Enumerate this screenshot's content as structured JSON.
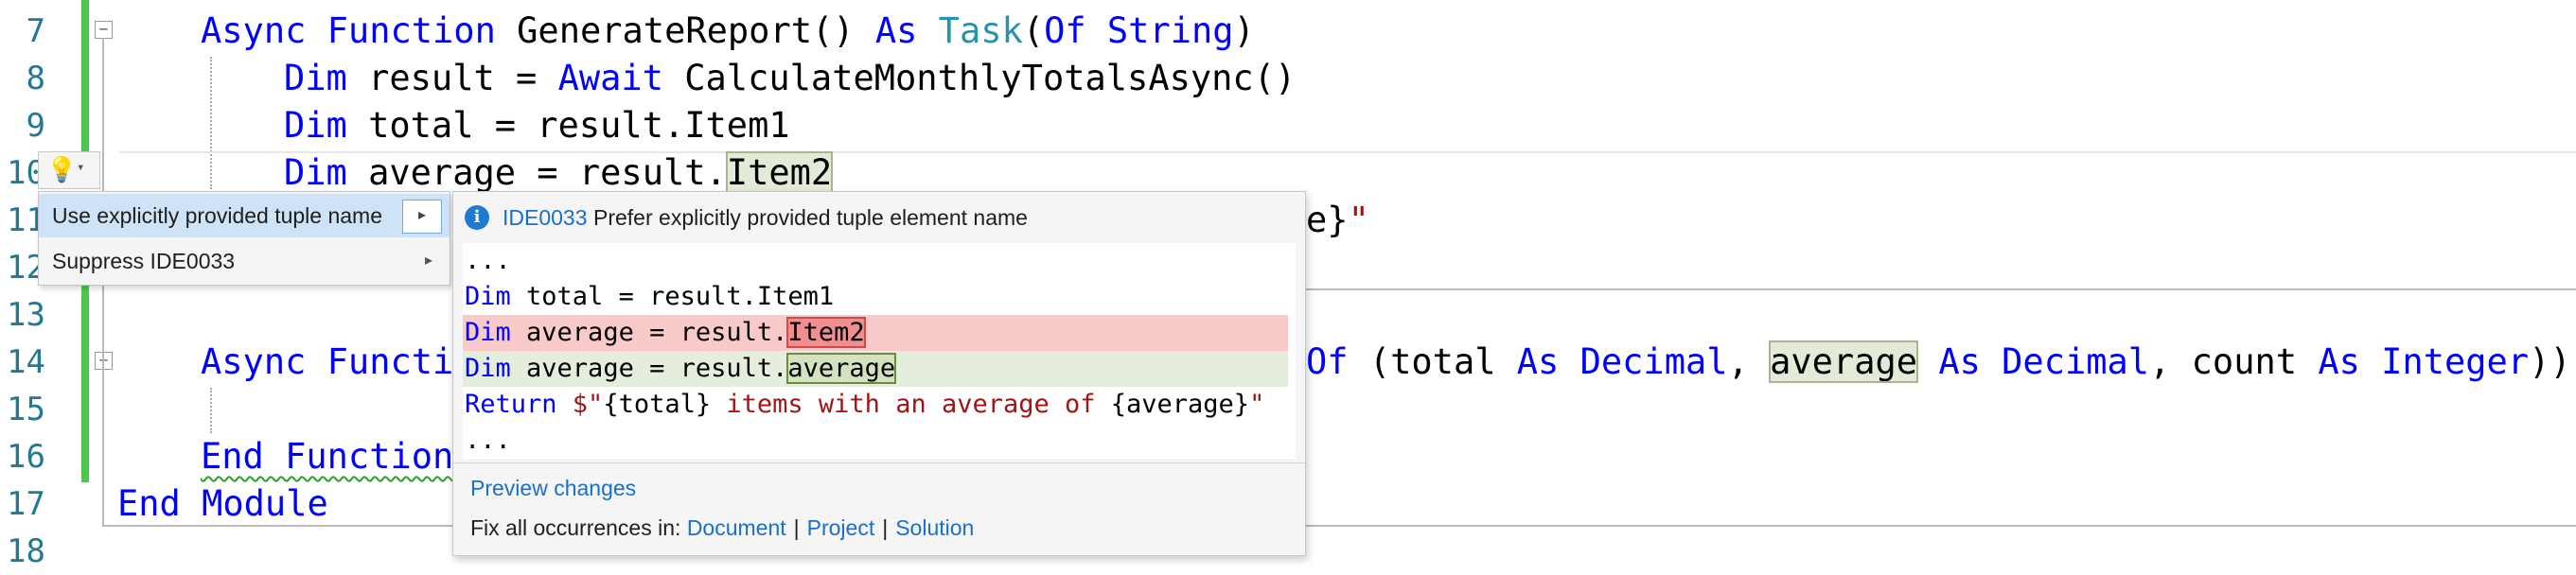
{
  "editor": {
    "line_numbers": [
      "7",
      "8",
      "9",
      "10",
      "11",
      "12",
      "13",
      "14",
      "15",
      "16",
      "17",
      "18"
    ],
    "lines": {
      "l7": {
        "kw1": "Async Function",
        "name": " GenerateReport() ",
        "kw2": "As ",
        "ty": "Task",
        "rest1": "(",
        "kw3": "Of String",
        "rest2": ")"
      },
      "l8": {
        "kw1": "Dim",
        "t1": " result = ",
        "kw2": "Await",
        "t2": " CalculateMonthlyTotalsAsync()"
      },
      "l9": {
        "kw1": "Dim",
        "t1": " total = result.Item1"
      },
      "l10": {
        "kw1": "Dim",
        "t1": " average = result.",
        "hl": "Item2"
      },
      "l11_tail": {
        "t": "e}",
        "str": "\""
      },
      "l14": {
        "kw1": "Async Functi",
        "kw2": "Of",
        "t1": " (total ",
        "kw3": "As Decimal",
        "t2": ", ",
        "hl": "average",
        "t3": " ",
        "kw4": "As Decimal",
        "t4": ", count ",
        "kw5": "As Integer",
        "t5": "))"
      },
      "l16": {
        "kw1": "End Function"
      },
      "l17": {
        "kw1": "End Module"
      }
    }
  },
  "menu": {
    "items": [
      {
        "label": "Use explicitly provided tuple name"
      },
      {
        "label": "Suppress IDE0033"
      }
    ],
    "submenu_arrow": "▸"
  },
  "preview": {
    "diagnostic_id": "IDE0033",
    "title": "Prefer explicitly provided tuple element name",
    "code": {
      "l1": "...",
      "l2_kw": "Dim",
      "l2_t": " total = result.Item1",
      "l3_kw": "Dim",
      "l3_t": " average = result.",
      "l3_mark": "Item2",
      "l4_kw": "Dim",
      "l4_t": " average = result.",
      "l4_mark": "average",
      "l5_kw": "Return",
      "l5_s1": " $\"",
      "l5_t1": "{total}",
      "l5_s2": " items with an average of ",
      "l5_t2": "{average}",
      "l5_s3": "\"",
      "l6": "..."
    },
    "preview_changes": "Preview changes",
    "fix_all_label": "Fix all occurrences in: ",
    "fix_links": [
      "Document",
      "Project",
      "Solution"
    ],
    "separator": "|"
  },
  "colors": {
    "keyword": "#0000ff",
    "type": "#2b91af",
    "string": "#a31515",
    "link": "#1a6fc9",
    "change_bar": "#4cc94c"
  },
  "icons": {
    "lightbulb": "lightbulb-icon",
    "info": "info-icon"
  }
}
